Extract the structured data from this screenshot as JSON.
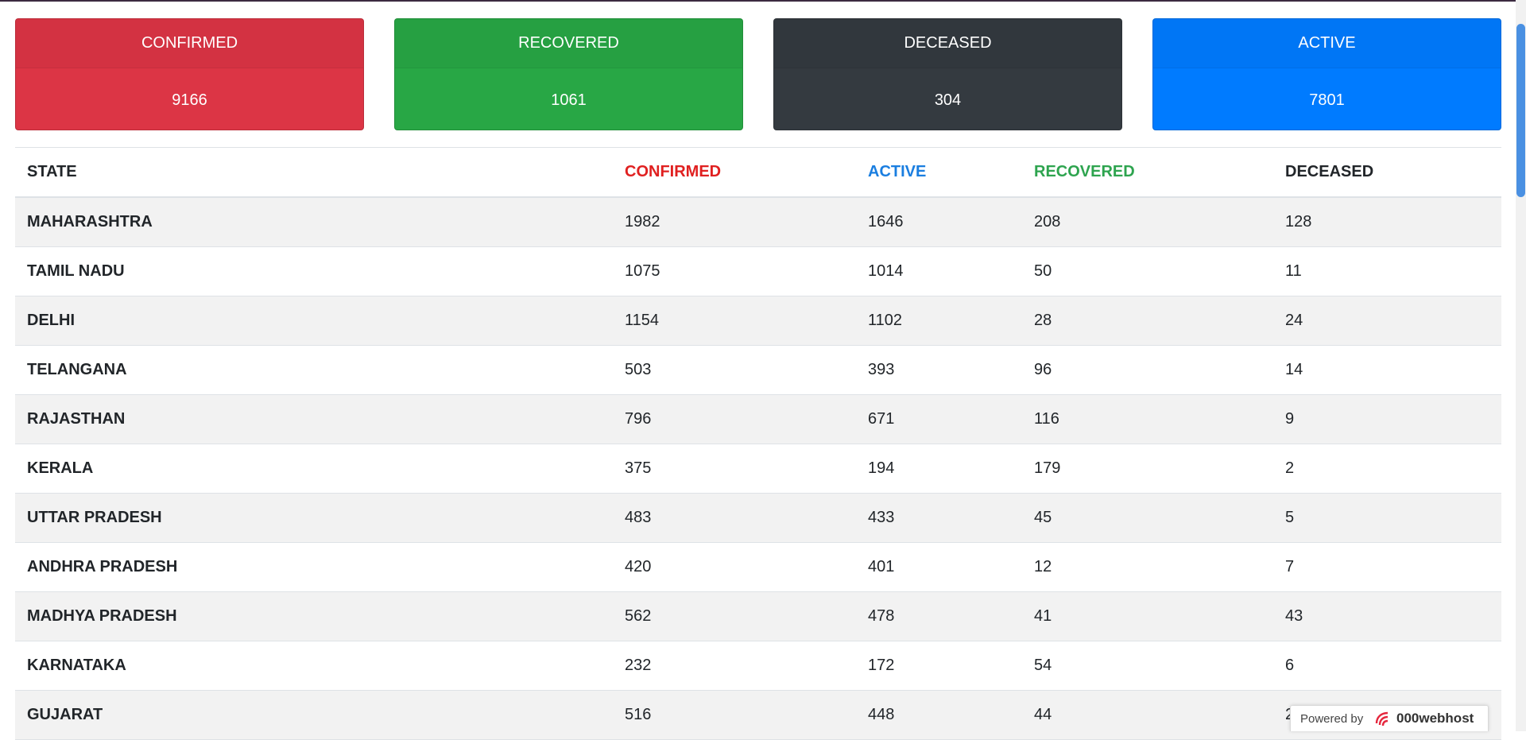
{
  "cards": [
    {
      "label": "CONFIRMED",
      "value": "9166",
      "color": "#dc3545"
    },
    {
      "label": "RECOVERED",
      "value": "1061",
      "color": "#28a745"
    },
    {
      "label": "DECEASED",
      "value": "304",
      "color": "#343a40"
    },
    {
      "label": "ACTIVE",
      "value": "7801",
      "color": "#007bff"
    }
  ],
  "table": {
    "headers": {
      "state": "STATE",
      "confirmed": "CONFIRMED",
      "active": "ACTIVE",
      "recovered": "RECOVERED",
      "deceased": "DECEASED"
    },
    "header_colors": {
      "confirmed": "#e02020",
      "active": "#1a7ee0",
      "recovered": "#2ea44f",
      "deceased": "#212529"
    },
    "rows": [
      {
        "state": "MAHARASHTRA",
        "confirmed": "1982",
        "active": "1646",
        "recovered": "208",
        "deceased": "128"
      },
      {
        "state": "TAMIL NADU",
        "confirmed": "1075",
        "active": "1014",
        "recovered": "50",
        "deceased": "11"
      },
      {
        "state": "DELHI",
        "confirmed": "1154",
        "active": "1102",
        "recovered": "28",
        "deceased": "24"
      },
      {
        "state": "TELANGANA",
        "confirmed": "503",
        "active": "393",
        "recovered": "96",
        "deceased": "14"
      },
      {
        "state": "RAJASTHAN",
        "confirmed": "796",
        "active": "671",
        "recovered": "116",
        "deceased": "9"
      },
      {
        "state": "KERALA",
        "confirmed": "375",
        "active": "194",
        "recovered": "179",
        "deceased": "2"
      },
      {
        "state": "UTTAR PRADESH",
        "confirmed": "483",
        "active": "433",
        "recovered": "45",
        "deceased": "5"
      },
      {
        "state": "ANDHRA PRADESH",
        "confirmed": "420",
        "active": "401",
        "recovered": "12",
        "deceased": "7"
      },
      {
        "state": "MADHYA PRADESH",
        "confirmed": "562",
        "active": "478",
        "recovered": "41",
        "deceased": "43"
      },
      {
        "state": "KARNATAKA",
        "confirmed": "232",
        "active": "172",
        "recovered": "54",
        "deceased": "6"
      },
      {
        "state": "GUJARAT",
        "confirmed": "516",
        "active": "448",
        "recovered": "44",
        "deceased": "24"
      }
    ]
  },
  "footer": {
    "powered_by": "Powered by",
    "brand": "000webhost",
    "logo_icon": "000webhost-logo-icon"
  }
}
